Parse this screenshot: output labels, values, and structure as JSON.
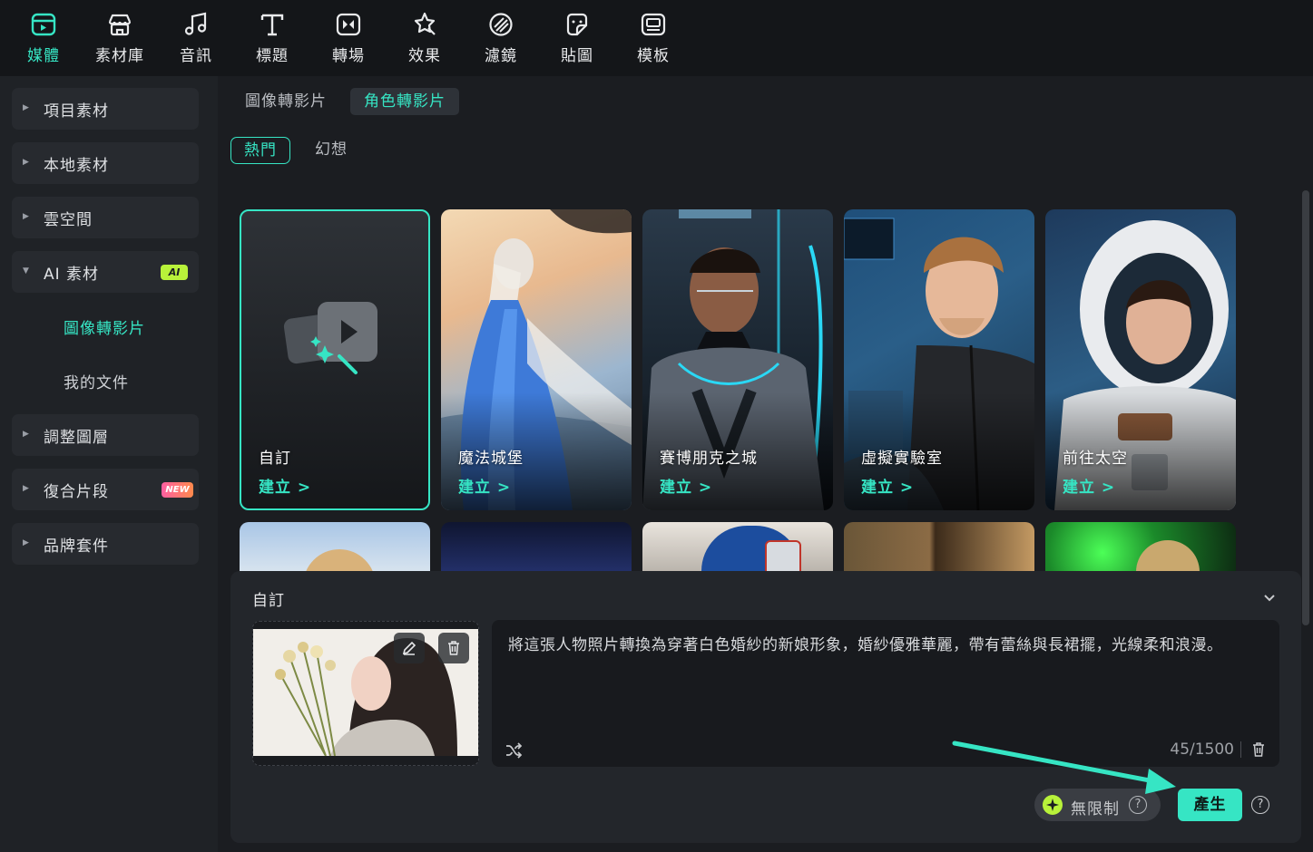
{
  "toolbar": {
    "items": [
      {
        "label": "媒體",
        "icon": "media-icon",
        "active": true
      },
      {
        "label": "素材庫",
        "icon": "store-icon"
      },
      {
        "label": "音訊",
        "icon": "music-icon"
      },
      {
        "label": "標題",
        "icon": "title-icon"
      },
      {
        "label": "轉場",
        "icon": "transition-icon"
      },
      {
        "label": "效果",
        "icon": "effects-icon"
      },
      {
        "label": "濾鏡",
        "icon": "filter-icon"
      },
      {
        "label": "貼圖",
        "icon": "sticker-icon"
      },
      {
        "label": "模板",
        "icon": "template-icon"
      }
    ]
  },
  "sidebar": {
    "items": [
      {
        "label": "項目素材"
      },
      {
        "label": "本地素材"
      },
      {
        "label": "雲空間"
      },
      {
        "label": "AI 素材",
        "badge": "AI",
        "expanded": true
      },
      {
        "label": "調整圖層"
      },
      {
        "label": "復合片段",
        "badge": "NEW"
      },
      {
        "label": "品牌套件"
      }
    ],
    "ai_children": [
      {
        "label": "圖像轉影片",
        "active": true
      },
      {
        "label": "我的文件"
      }
    ]
  },
  "tabs": [
    "圖像轉影片",
    "角色轉影片"
  ],
  "active_tab": "角色轉影片",
  "chips": [
    "熱門",
    "幻想"
  ],
  "active_chip": "熱門",
  "cards": [
    {
      "name": "自訂",
      "action": "建立 >"
    },
    {
      "name": "魔法城堡",
      "action": "建立 >"
    },
    {
      "name": "賽博朋克之城",
      "action": "建立 >"
    },
    {
      "name": "虛擬實驗室",
      "action": "建立 >"
    },
    {
      "name": "前往太空",
      "action": "建立 >"
    }
  ],
  "panel": {
    "title": "自訂",
    "prompt": "將這張人物照片轉換為穿著白色婚紗的新娘形象，婚紗優雅華麗，帶有蕾絲與長裙擺，光線柔和浪漫。",
    "counter": "45/1500",
    "plan_label": "無限制",
    "generate_label": "產生"
  },
  "colors": {
    "accent": "#36e5c4",
    "panel": "#23262b",
    "background": "#1b1d21"
  }
}
